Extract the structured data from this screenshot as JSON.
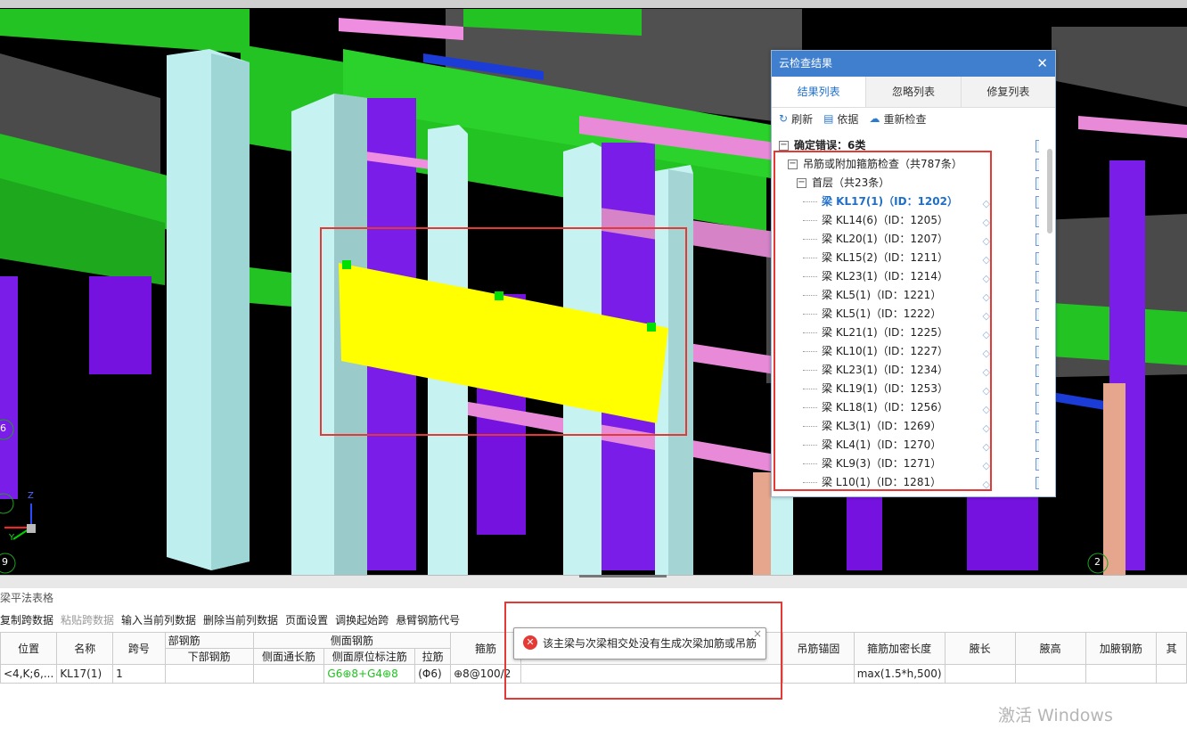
{
  "panel": {
    "title": "云检查结果",
    "close": "✕",
    "tabs": [
      "结果列表",
      "忽略列表",
      "修复列表"
    ],
    "toolbar": {
      "refresh": "刷新",
      "basis": "依据",
      "recheck": "重新检查"
    },
    "tree": {
      "root": "确定错误：6类",
      "category": "吊筋或附加箍筋检查（共787条）",
      "floor": "首层（共23条）",
      "items": [
        "梁 KL17(1)（ID：1202）",
        "梁 KL14(6)（ID：1205）",
        "梁 KL20(1)（ID：1207）",
        "梁 KL15(2)（ID：1211）",
        "梁 KL23(1)（ID：1214）",
        "梁 KL5(1)（ID：1221）",
        "梁 KL5(1)（ID：1222）",
        "梁 KL21(1)（ID：1225）",
        "梁 KL10(1)（ID：1227）",
        "梁 KL23(1)（ID：1234）",
        "梁 KL19(1)（ID：1253）",
        "梁 KL18(1)（ID：1256）",
        "梁 KL3(1)（ID：1269）",
        "梁 KL4(1)（ID：1270）",
        "梁 KL9(3)（ID：1271）",
        "梁 L10(1)（ID：1281）"
      ]
    }
  },
  "bottom": {
    "title": "梁平法表格",
    "toolbar": [
      "复制跨数据",
      "粘贴跨数据",
      "输入当前列数据",
      "删除当前列数据",
      "页面设置",
      "调换起始跨",
      "悬臂钢筋代号"
    ],
    "headers": {
      "position": "位置",
      "name": "名称",
      "span": "跨号",
      "bottom_group": "部钢筋",
      "bottom_rebar": "下部钢筋",
      "side_group": "侧面钢筋",
      "side_long": "侧面通长筋",
      "side_orig": "侧面原位标注筋",
      "tie": "拉筋",
      "stirrup": "箍筋",
      "hanger_anchor": "吊筋锚固",
      "dense_len": "箍筋加密长度",
      "haunch_len": "腋长",
      "haunch_h": "腋高",
      "haunch_rebar": "加腋钢筋",
      "more": "其"
    },
    "row": {
      "position": "<4,K;6,...",
      "name": "KL17(1)",
      "span": "1",
      "side_orig": "G6⊕8+G4⊕8",
      "tie": "(Φ6)",
      "stirrup": "⊕8@100/2",
      "dense_len": "max(1.5*h,500)"
    }
  },
  "popup": {
    "message": "该主梁与次梁相交处没有生成次梁加筋或吊筋",
    "close": "×",
    "icon": "✕"
  },
  "watermark": "激活 Windows",
  "viewport": {
    "axis_z": "Z",
    "axis_y": "Y",
    "grid_marks": [
      "6",
      "9",
      "2"
    ]
  }
}
